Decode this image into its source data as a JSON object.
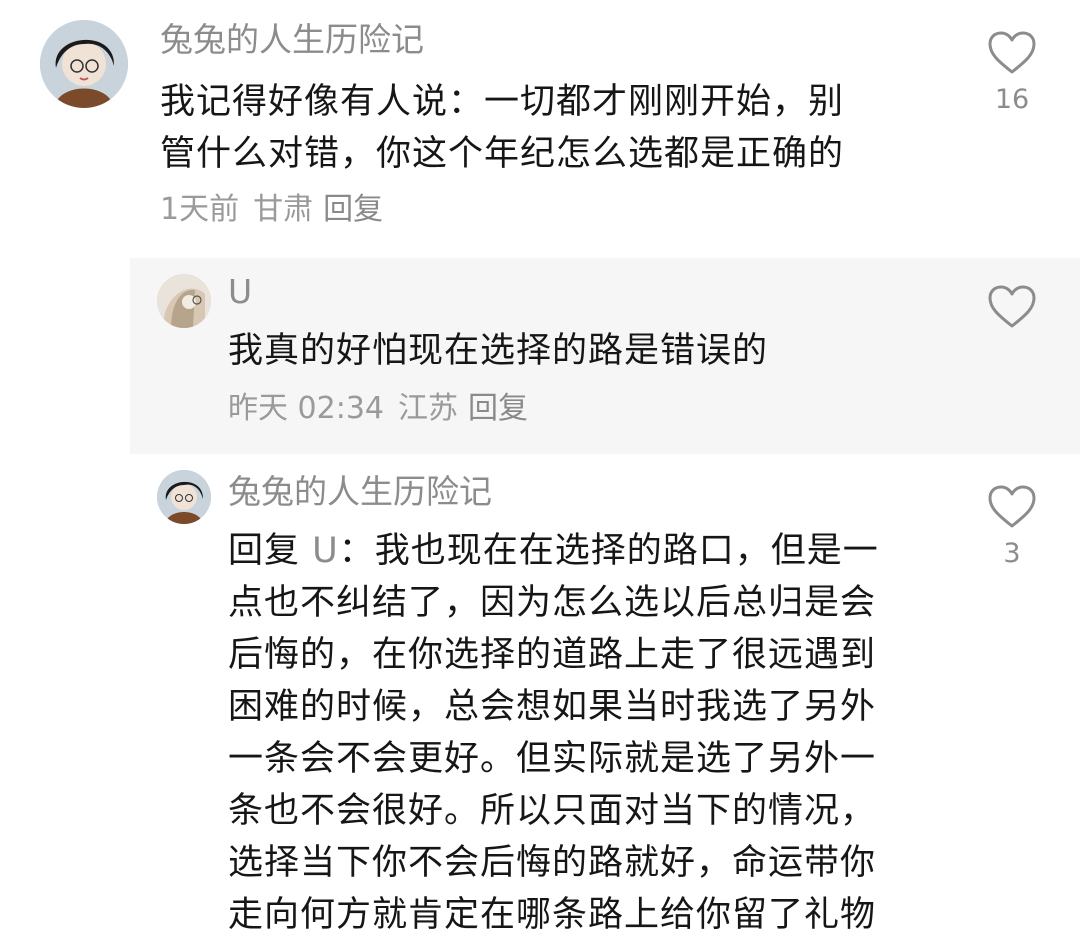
{
  "comments": [
    {
      "username": "兔兔的人生历险记",
      "lines": [
        "我记得好像有人说：一切都才刚刚开始，别",
        "管什么对错，你这个年纪怎么选都是正确的"
      ],
      "time": "1天前",
      "location": "甘肃",
      "reply_label": "回复",
      "likes": "16"
    },
    {
      "username": "U",
      "lines": [
        "我真的好怕现在选择的路是错误的"
      ],
      "time": "昨天 02:34",
      "location": "江苏",
      "reply_label": "回复",
      "likes": ""
    },
    {
      "username": "兔兔的人生历险记",
      "reply_prefix": "回复",
      "reply_target": "U",
      "first_line_rest": "：我也现在在选择的路口，但是一",
      "lines": [
        "点也不纠结了，因为怎么选以后总归是会",
        "后悔的，在你选择的道路上走了很远遇到",
        "困难的时候，总会想如果当时我选了另外",
        "一条会不会更好。但实际就是选了另外一",
        "条也不会很好。所以只面对当下的情况，",
        "选择当下你不会后悔的路就好，命运带你",
        "走向何方就肯定在哪条路上给你留了礼物"
      ],
      "likes": "3"
    }
  ],
  "icons": {
    "like": "heart-outline-icon"
  },
  "colors": {
    "text": "#161616",
    "muted": "#8c8c8c",
    "reply_bg": "#f6f6f6"
  }
}
